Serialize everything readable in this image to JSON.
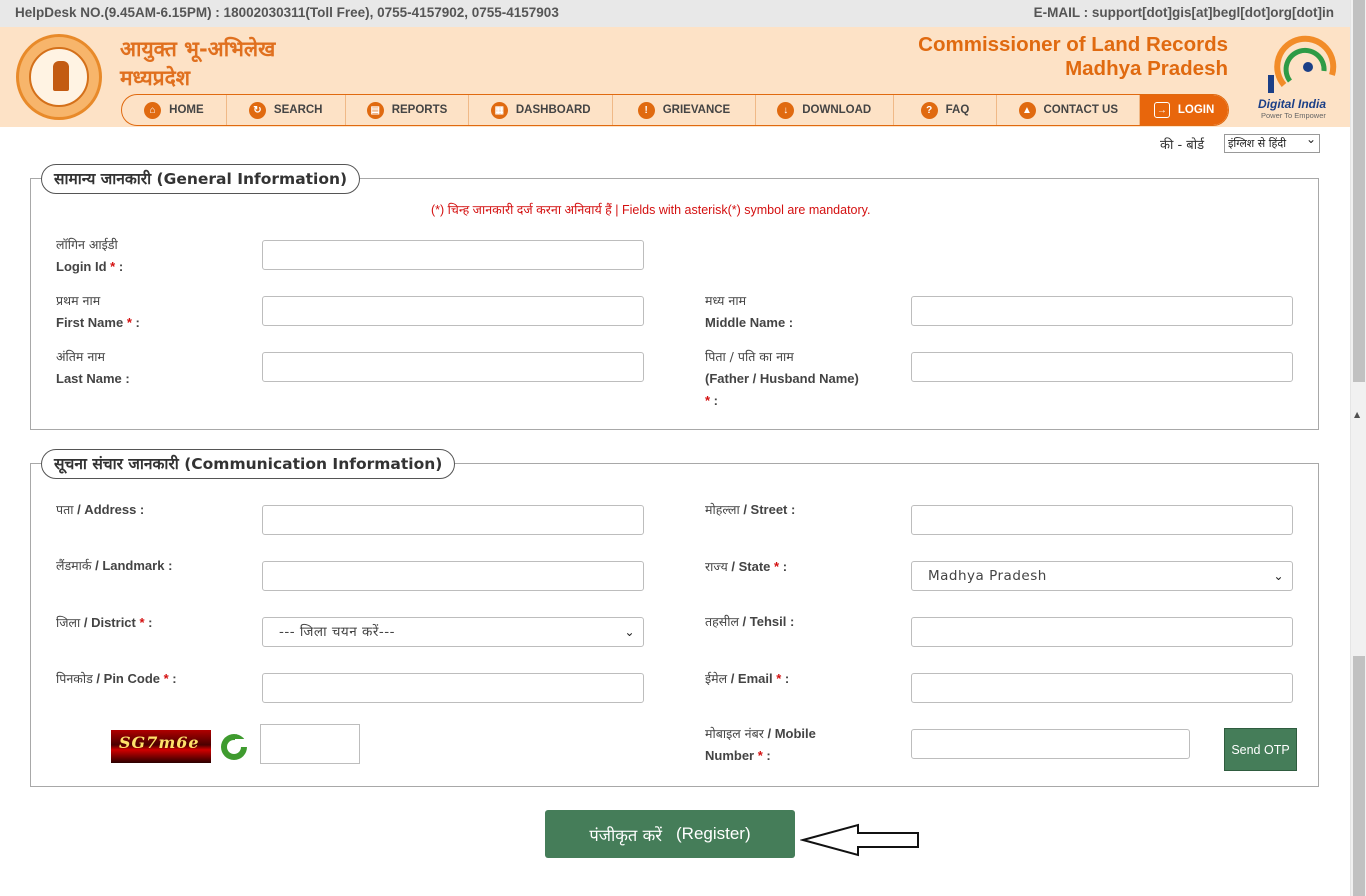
{
  "topbar": {
    "helpdesk": "HelpDesk NO.(9.45AM-6.15PM) : 18002030311(Toll Free), 0755-4157902, 0755-4157903",
    "email": "E-MAIL : support[dot]gis[at]begl[dot]org[dot]in"
  },
  "header": {
    "hindi_line1": "आयुक्त भू-अभिलेख",
    "hindi_line2": "मध्यप्रदेश",
    "eng_line1": "Commissioner of Land Records",
    "eng_line2": "Madhya Pradesh",
    "digital_india": "Digital India",
    "digital_india_tag": "Power To Empower"
  },
  "nav": [
    {
      "label": "HOME",
      "icon": "home-icon",
      "glyph": "⌂"
    },
    {
      "label": "SEARCH",
      "icon": "search-icon",
      "glyph": "↻"
    },
    {
      "label": "REPORTS",
      "icon": "reports-icon",
      "glyph": "▤"
    },
    {
      "label": "DASHBOARD",
      "icon": "dashboard-icon",
      "glyph": "▦"
    },
    {
      "label": "GRIEVANCE",
      "icon": "grievance-icon",
      "glyph": "!"
    },
    {
      "label": "DOWNLOAD",
      "icon": "download-icon",
      "glyph": "↓"
    },
    {
      "label": "FAQ",
      "icon": "faq-icon",
      "glyph": "?"
    },
    {
      "label": "CONTACT US",
      "icon": "contact-icon",
      "glyph": "▲"
    },
    {
      "label": "LOGIN",
      "icon": "login-icon",
      "glyph": "→"
    }
  ],
  "keyboard": {
    "label": "की - बोर्ड",
    "selected": "इंग्लिश से हिंदी"
  },
  "general": {
    "legend": "सामान्य जानकारी (General Information)",
    "mandatory_note": "(*) चिन्ह जानकारी दर्ज करना अनिवार्य हैं | Fields with asterisk(*) symbol are mandatory.",
    "login_id_hi": "लॉगिन आईडी",
    "login_id_en": "Login Id",
    "first_name_hi": "प्रथम नाम",
    "first_name_en": "First Name",
    "middle_name_hi": "मध्य नाम",
    "middle_name_en": "Middle Name :",
    "last_name_hi": "अंतिम नाम",
    "last_name_en": "Last Name :",
    "father_hi": "पिता / पति का नाम",
    "father_en": "(Father / Husband Name)"
  },
  "communication": {
    "legend": "सूचना संचार जानकारी (Communication Information)",
    "address_hi": "पता",
    "address_en": " / Address :",
    "street_hi": "मोहल्ला",
    "street_en": " / Street :",
    "landmark_hi": "लैंडमार्क",
    "landmark_en": " / Landmark :",
    "state_hi": "राज्य",
    "state_en": " / State ",
    "state_value": "Madhya Pradesh",
    "district_hi": "जिला",
    "district_en": " / District ",
    "district_placeholder": "--- जिला चयन करें---",
    "tehsil_hi": "तहसील",
    "tehsil_en": " / Tehsil :",
    "pincode_hi": "पिनकोड",
    "pincode_en": " / Pin Code ",
    "email_hi": "ईमेल",
    "email_en": " / Email ",
    "mobile_hi": "मोबाइल नंबर",
    "mobile_en": " / Mobile",
    "mobile_en2": "Number ",
    "captcha_text": "SG7m6e",
    "send_otp": "Send OTP"
  },
  "register": {
    "hindi": "पंजीकृत करें",
    "english": "(Register)"
  },
  "colors": {
    "accent": "#e8660c",
    "header_bg": "#fde2c6",
    "button_green": "#457d59",
    "mandatory_red": "#d41010"
  }
}
